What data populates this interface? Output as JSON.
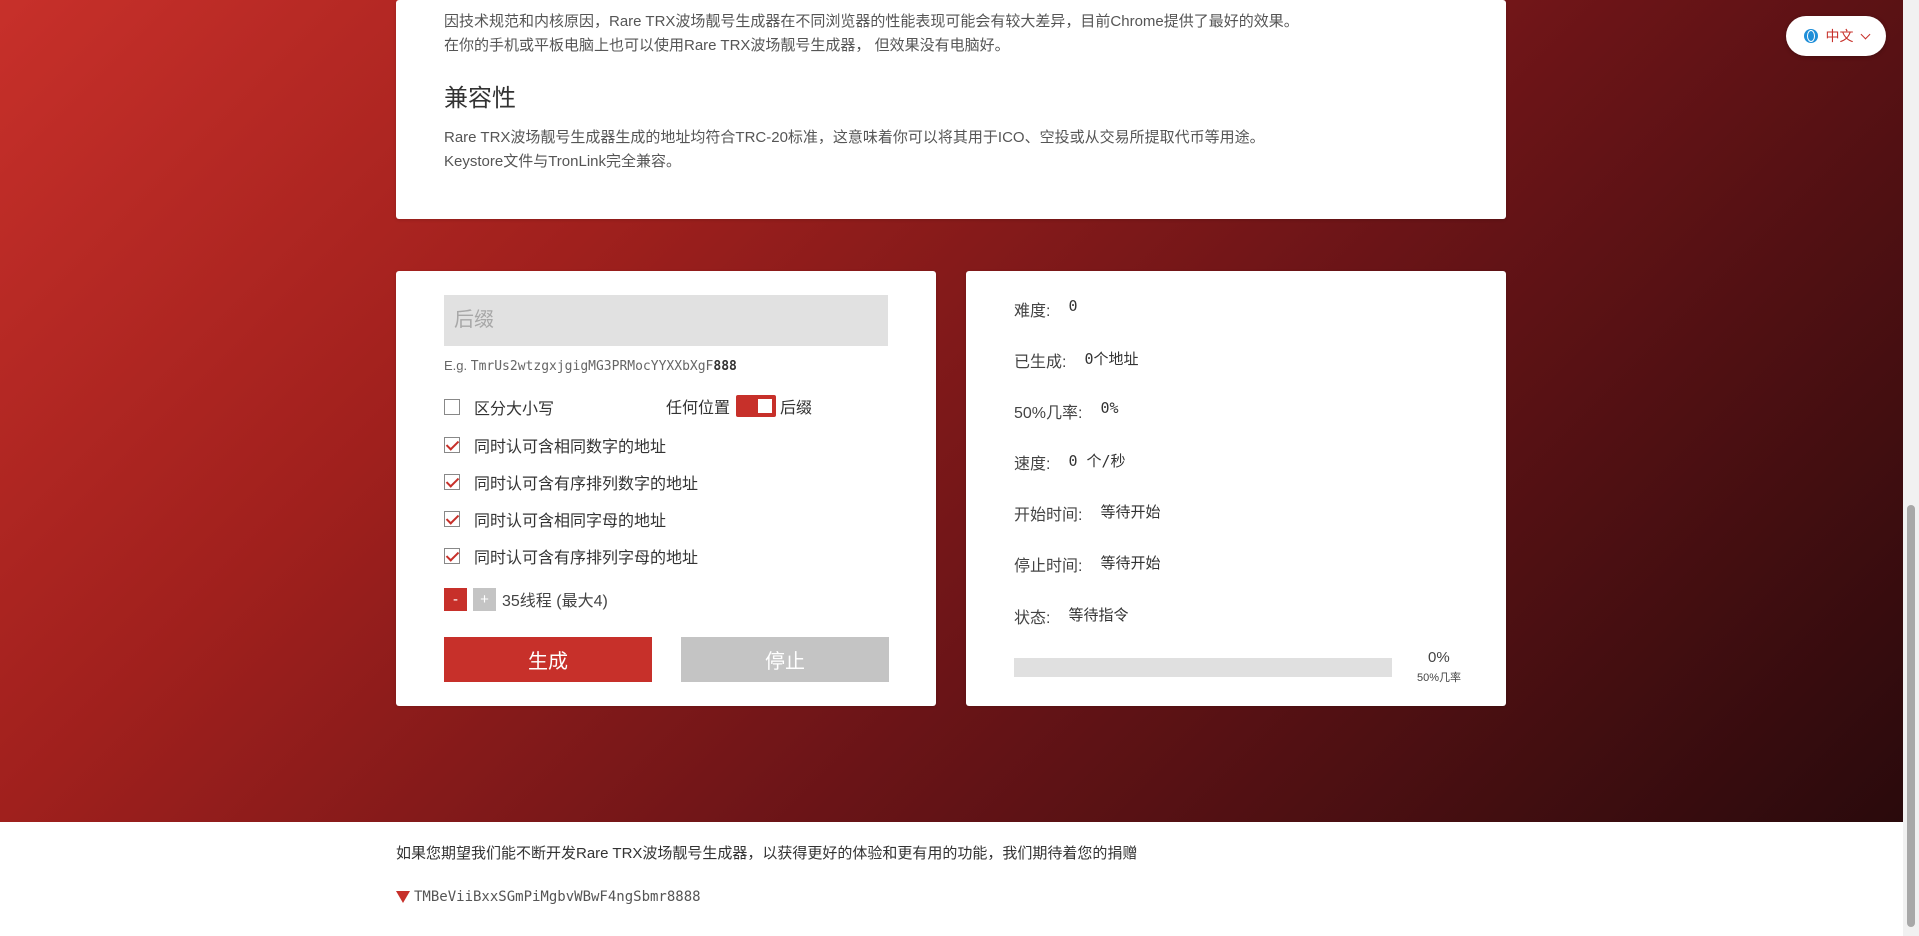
{
  "intro": {
    "browser_note_line1": "因技术规范和内核原因，Rare TRX波场靓号生成器在不同浏览器的性能表现可能会有较大差异，目前Chrome提供了最好的效果。",
    "browser_note_line2": "在你的手机或平板电脑上也可以使用Rare TRX波场靓号生成器， 但效果没有电脑好。",
    "compat_title": "兼容性",
    "compat_line1": "Rare TRX波场靓号生成器生成的地址均符合TRC-20标准，这意味着你可以将其用于ICO、空投或从交易所提取代币等用途。",
    "compat_line2": "Keystore文件与TronLink完全兼容。"
  },
  "form": {
    "suffix_placeholder": "后缀",
    "suffix_value": "",
    "example_prefix": "E.g. ",
    "example_address": "TmrUs2wtzgxjgigMG3PRMocYYXXbXgF",
    "example_suffix": "888",
    "case_sensitive": {
      "label": "区分大小写",
      "checked": false
    },
    "position": {
      "left_label": "任何位置",
      "right_label": "后缀",
      "state": "后缀"
    },
    "options": [
      {
        "label": "同时认可含相同数字的地址",
        "checked": true
      },
      {
        "label": "同时认可含有序排列数字的地址",
        "checked": true
      },
      {
        "label": "同时认可含相同字母的地址",
        "checked": true
      },
      {
        "label": "同时认可含有序排列字母的地址",
        "checked": true
      }
    ],
    "threads_minus": "-",
    "threads_plus": "+",
    "threads_label": "35线程 (最大4)",
    "generate_label": "生成",
    "stop_label": "停止"
  },
  "stats": {
    "difficulty_label": "难度:",
    "difficulty_value": "0",
    "generated_label": "已生成:",
    "generated_value": "0个地址",
    "prob_label": "50%几率:",
    "prob_value": "0%",
    "speed_label": "速度:",
    "speed_value": "0 个/秒",
    "start_label": "开始时间:",
    "start_value": "等待开始",
    "stop_label": "停止时间:",
    "stop_value": "等待开始",
    "status_label": "状态:",
    "status_value": "等待指令",
    "progress_percent": "0%",
    "progress_value": 0,
    "progress_caption": "50%几率"
  },
  "language": {
    "label": "中文"
  },
  "footer": {
    "donate_text": "如果您期望我们能不断开发Rare TRX波场靓号生成器，以获得更好的体验和更有用的功能，我们期待着您的捐赠",
    "donate_address": "TMBeViiBxxSGmPiMgbvWBwF4ngSbmr8888"
  },
  "colors": {
    "accent": "#c7302a",
    "disabled": "#c4c4c4"
  }
}
